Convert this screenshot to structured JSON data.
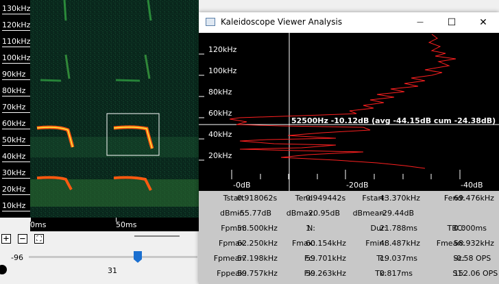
{
  "spectrogram": {
    "freq_labels": [
      "130kHz",
      "120kHz",
      "110kHz",
      "100kHz",
      "90kHz",
      "80kHz",
      "70kHz",
      "60kHz",
      "50kHz",
      "40kHz",
      "30kHz",
      "20kHz",
      "10kHz"
    ],
    "time_labels": [
      "0ms",
      "50ms"
    ]
  },
  "controls": {
    "zoom_in": "+",
    "zoom_out": "−",
    "fit": "⛶",
    "level_value": "-96",
    "slider_value": "31"
  },
  "analysis_window": {
    "title": "Kaleidoscope Viewer Analysis",
    "minimize": "—",
    "maximize": "☐",
    "close": "✕",
    "y_labels": [
      "120kHz",
      "100kHz",
      "80kHz",
      "60kHz",
      "40kHz",
      "20kHz"
    ],
    "x_labels": [
      "-0dB",
      "-20dB",
      "-40dB"
    ],
    "readout": "52500Hz -10.12dB (avg -44.15dB cum -24.38dB)",
    "stats": [
      [
        [
          "Tstart:",
          "0.918062s"
        ],
        [
          "Tend:",
          "0.949442s"
        ],
        [
          "Fstart:",
          "43.370kHz"
        ],
        [
          "Fend:",
          "69.476kHz"
        ]
      ],
      [
        [
          "dBmin:",
          "-55.77dB"
        ],
        [
          "dBmax:",
          "-20.95dB"
        ],
        [
          "dBmean:",
          "-29.44dB"
        ],
        [
          "",
          ""
        ]
      ],
      [
        [
          "Fpmin:",
          "58.500kHz"
        ],
        [
          "N:",
          "1"
        ],
        [
          "Dur:",
          "21.788ms"
        ],
        [
          "TBC:",
          "0.000ms"
        ]
      ],
      [
        [
          "Fpmax:",
          "62.250kHz"
        ],
        [
          "Fmax:",
          "60.154kHz"
        ],
        [
          "Fmin:",
          "48.487kHz"
        ],
        [
          "Fmean:",
          "58.932kHz"
        ]
      ],
      [
        [
          "Fpmean:",
          "57.198kHz"
        ],
        [
          "Fc:",
          "59.701kHz"
        ],
        [
          "Tc:",
          "19.037ms"
        ],
        [
          "Sc:",
          "-0.58 OPS"
        ]
      ],
      [
        [
          "Fppeak:",
          "59.757kHz"
        ],
        [
          "Fk:",
          "59.263kHz"
        ],
        [
          "Tk:",
          "0.817ms"
        ],
        [
          "S1:",
          "152.06 OPS"
        ]
      ]
    ]
  }
}
